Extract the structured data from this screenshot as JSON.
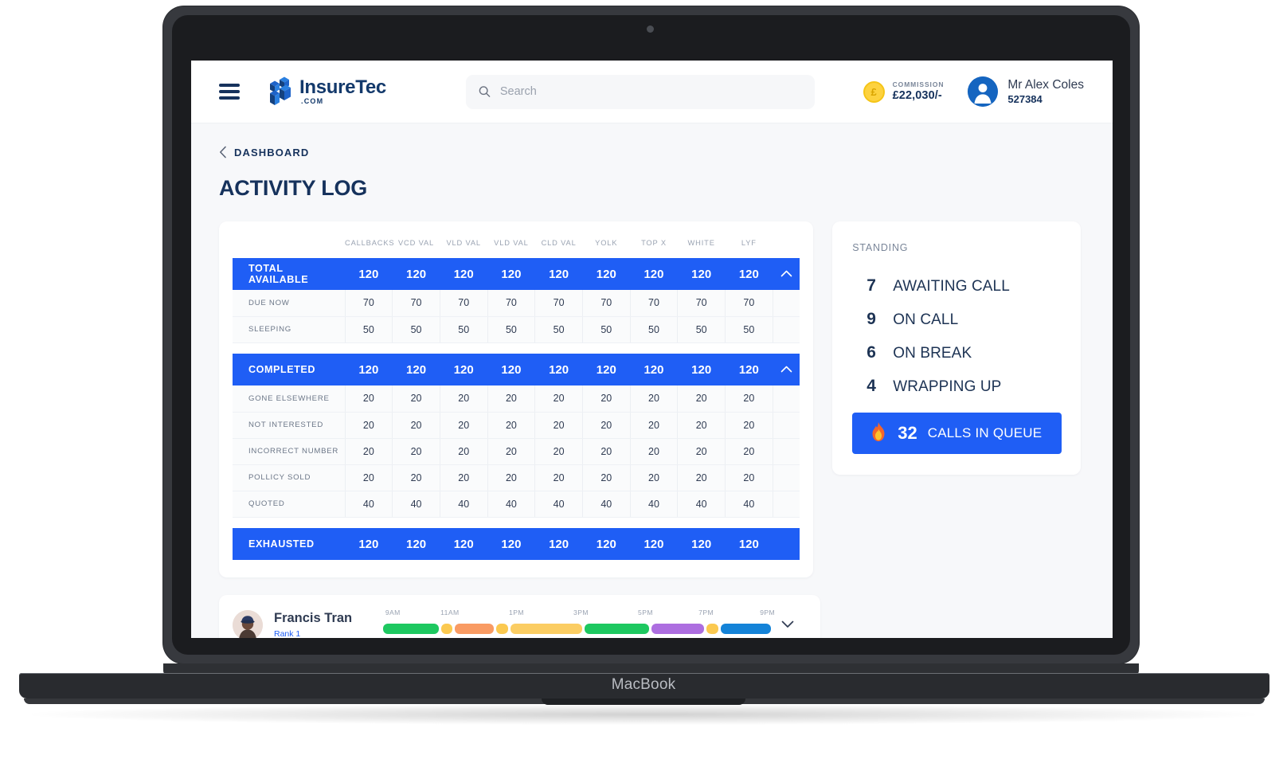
{
  "device": {
    "label": "MacBook"
  },
  "header": {
    "menu_icon": "hamburger-icon",
    "brand": {
      "name_part1": "Insure",
      "name_part2": "Tec",
      "suffix": ".COM"
    },
    "search": {
      "placeholder": "Search",
      "value": "",
      "icon": "search-icon"
    },
    "commission": {
      "label": "COMMISSION",
      "value": "£22,030/-",
      "icon": "coin-icon",
      "symbol": "£"
    },
    "user": {
      "name": "Mr Alex Coles",
      "id": "527384",
      "icon": "avatar-icon"
    }
  },
  "breadcrumb": {
    "icon": "chevron-left-icon",
    "label": "DASHBOARD"
  },
  "page_title": "ACTIVITY LOG",
  "table": {
    "columns": [
      "CALLBACKS",
      "VCD VAL",
      "VLD VAL",
      "VLD VAL",
      "CLD VAL",
      "YOLK",
      "TOP X",
      "WHITE",
      "LYF"
    ],
    "sections": [
      {
        "type": "group",
        "label": "TOTAL AVAILABLE",
        "values": [
          "120",
          "120",
          "120",
          "120",
          "120",
          "120",
          "120",
          "120",
          "120"
        ],
        "toggle_icon": "chevron-up-icon",
        "rows": [
          {
            "label": "DUE NOW",
            "values": [
              "70",
              "70",
              "70",
              "70",
              "70",
              "70",
              "70",
              "70",
              "70"
            ]
          },
          {
            "label": "SLEEPING",
            "values": [
              "50",
              "50",
              "50",
              "50",
              "50",
              "50",
              "50",
              "50",
              "50"
            ]
          }
        ]
      },
      {
        "type": "group",
        "label": "COMPLETED",
        "values": [
          "120",
          "120",
          "120",
          "120",
          "120",
          "120",
          "120",
          "120",
          "120"
        ],
        "toggle_icon": "chevron-up-icon",
        "rows": [
          {
            "label": "GONE ELSEWHERE",
            "values": [
              "20",
              "20",
              "20",
              "20",
              "20",
              "20",
              "20",
              "20",
              "20"
            ]
          },
          {
            "label": "NOT INTERESTED",
            "values": [
              "20",
              "20",
              "20",
              "20",
              "20",
              "20",
              "20",
              "20",
              "20"
            ]
          },
          {
            "label": "INCORRECT NUMBER",
            "values": [
              "20",
              "20",
              "20",
              "20",
              "20",
              "20",
              "20",
              "20",
              "20"
            ]
          },
          {
            "label": "POLLICY SOLD",
            "values": [
              "20",
              "20",
              "20",
              "20",
              "20",
              "20",
              "20",
              "20",
              "20"
            ]
          },
          {
            "label": "QUOTED",
            "values": [
              "40",
              "40",
              "40",
              "40",
              "40",
              "40",
              "40",
              "40",
              "40"
            ]
          }
        ]
      },
      {
        "type": "group",
        "label": "EXHAUSTED",
        "values": [
          "120",
          "120",
          "120",
          "120",
          "120",
          "120",
          "120",
          "120",
          "120"
        ],
        "toggle_icon": "",
        "rows": []
      }
    ]
  },
  "standing": {
    "title": "STANDING",
    "items": [
      {
        "count": "7",
        "label": "AWAITING CALL"
      },
      {
        "count": "9",
        "label": "ON CALL"
      },
      {
        "count": "6",
        "label": "ON BREAK"
      },
      {
        "count": "4",
        "label": "WRAPPING UP"
      }
    ],
    "queue": {
      "icon": "flame-icon",
      "count": "32",
      "label": "CALLS IN QUEUE"
    }
  },
  "agent_row": {
    "name": "Francis Tran",
    "rank": "Rank 1",
    "expand_icon": "chevron-down-icon",
    "timeline": {
      "ticks": [
        {
          "label": "9AM",
          "left_pct": 1.4
        },
        {
          "label": "11AM",
          "left_pct": 15.5
        },
        {
          "label": "1PM",
          "left_pct": 33.0
        },
        {
          "label": "3PM",
          "left_pct": 49.5
        },
        {
          "label": "5PM",
          "left_pct": 66.0
        },
        {
          "label": "7PM",
          "left_pct": 81.5
        },
        {
          "label": "9PM",
          "left_pct": 97.2
        }
      ],
      "segments": [
        {
          "left_pct": 0.8,
          "width_pct": 14.2,
          "color": "#1ec860"
        },
        {
          "left_pct": 15.6,
          "width_pct": 3.0,
          "color": "#fbc950"
        },
        {
          "left_pct": 19.2,
          "width_pct": 10.0,
          "color": "#f99b63"
        },
        {
          "left_pct": 29.8,
          "width_pct": 3.0,
          "color": "#fbc950"
        },
        {
          "left_pct": 33.4,
          "width_pct": 18.4,
          "color": "#fbcd63"
        },
        {
          "left_pct": 52.4,
          "width_pct": 16.5,
          "color": "#1ec860"
        },
        {
          "left_pct": 69.5,
          "width_pct": 13.4,
          "color": "#ad6ee0"
        },
        {
          "left_pct": 83.5,
          "width_pct": 3.0,
          "color": "#fbc950"
        },
        {
          "left_pct": 87.1,
          "width_pct": 13.0,
          "color": "#1483d8"
        }
      ]
    }
  },
  "colors": {
    "brand_blue": "#1f5ef5",
    "navy": "#16325c",
    "page_bg": "#f7f8fa",
    "muted": "#9aa3b2"
  }
}
